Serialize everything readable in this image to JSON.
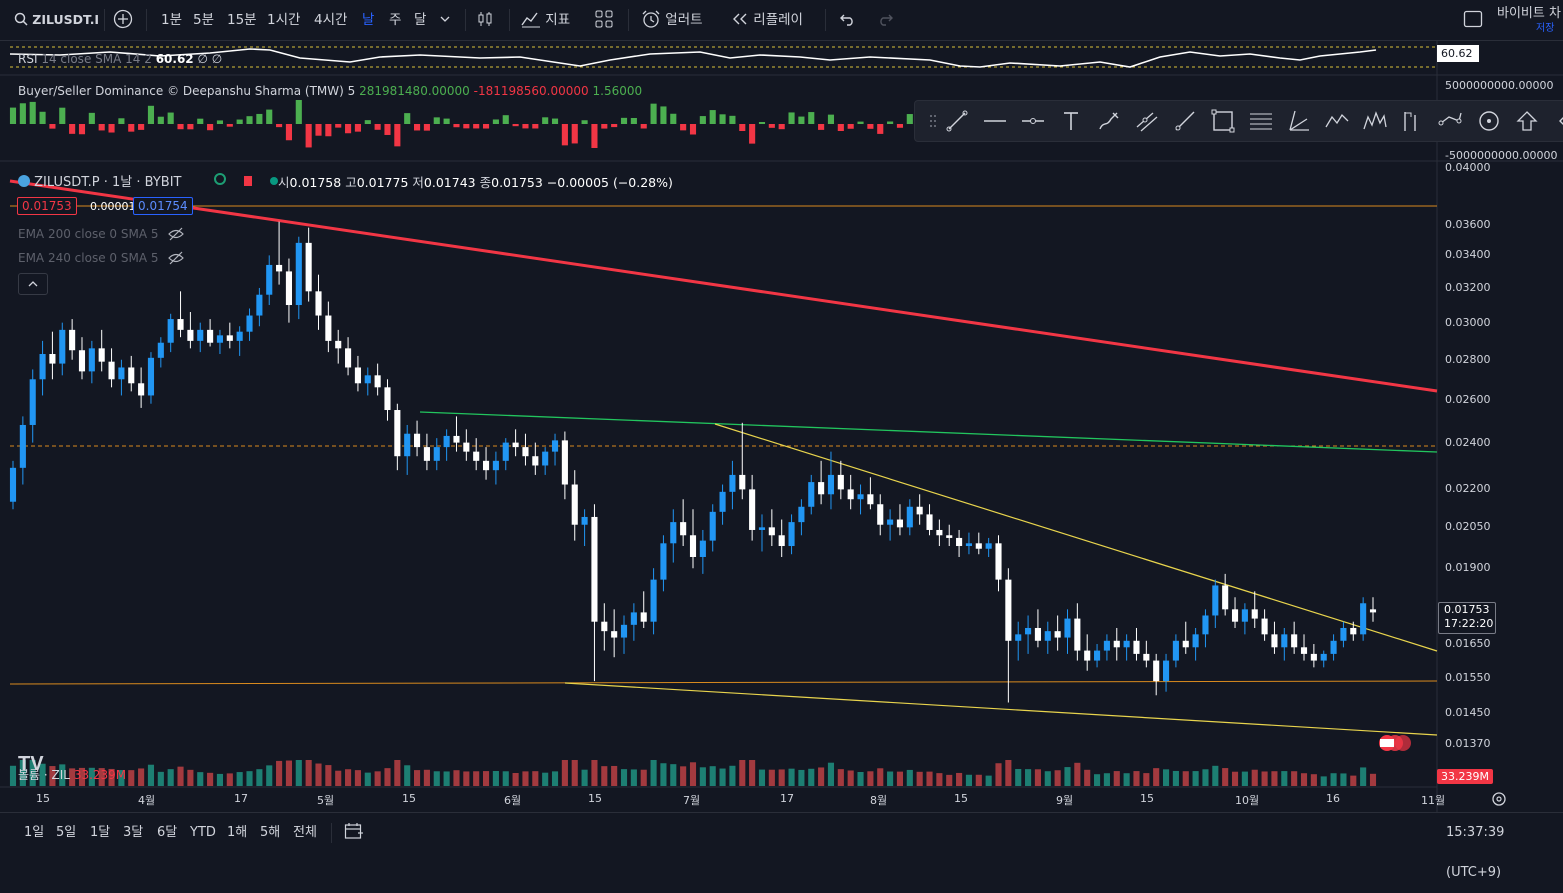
{
  "toolbar": {
    "symbol": "ZILUSDT.I",
    "timeframes": [
      "1분",
      "5분",
      "15분",
      "1시간",
      "4시간",
      "날",
      "주",
      "달"
    ],
    "active_timeframe": "날",
    "indicators_label": "지표",
    "alerts_label": "얼러트",
    "replay_label": "리플레이",
    "exchange_label": "바이비트 차",
    "save_label": "저장"
  },
  "rsi": {
    "label": "RSI",
    "params": "14 close SMA 14 2",
    "value": "60.62",
    "extra": "∅ ∅",
    "axis_value": "60.62"
  },
  "dominance": {
    "label": "Buyer/Seller Dominance © Deepanshu Sharma (TMW)",
    "param": "5",
    "v1": "281981480.00000",
    "v2": "-181198560.00000",
    "v3": "1.56000",
    "axis_top": "5000000000.00000",
    "axis_bottom": "-5000000000.00000"
  },
  "legend": {
    "symbol_line": "ZILUSDT.P · 1날 · BYBIT",
    "o_label": "시",
    "o": "0.01758",
    "h_label": "고",
    "h": "0.01775",
    "l_label": "저",
    "l": "0.01743",
    "c_label": "종",
    "c": "0.01753",
    "change": "−0.00005 (−0.28%)",
    "bid": "0.01753",
    "spread": "0.00001",
    "ask": "0.01754",
    "ema1": "EMA 200 close 0 SMA 5",
    "ema2": "EMA 240 close 0 SMA 5"
  },
  "price_axis": [
    "0.04000",
    "0.03600",
    "0.03400",
    "0.03200",
    "0.03000",
    "0.02800",
    "0.02600",
    "0.02400",
    "0.02200",
    "0.02050",
    "0.01900",
    "0.01650",
    "0.01550",
    "0.01450",
    "0.01370"
  ],
  "last_price": {
    "price": "0.01753",
    "countdown": "17:22:20"
  },
  "volume": {
    "label": "볼륨 · ZIL",
    "value": "33.239M",
    "axis_value": "33.239M"
  },
  "time_axis": [
    "15",
    "4월",
    "17",
    "5월",
    "15",
    "6월",
    "15",
    "7월",
    "17",
    "8월",
    "15",
    "9월",
    "15",
    "10월",
    "16",
    "11월"
  ],
  "bottom": {
    "ranges": [
      "1일",
      "5일",
      "1달",
      "3달",
      "6달",
      "YTD",
      "1해",
      "5해",
      "전체"
    ],
    "clock": "15:37:39 (UTC+9)"
  },
  "colors": {
    "background": "#131722",
    "up": "#2196f3",
    "down": "#ffffff",
    "red_trend": "#f23645",
    "green_trend": "#22c55e",
    "yellow_trend": "#e8d44d",
    "orange_level": "#d88a1e",
    "accent": "#2962ff"
  },
  "chart_data": {
    "type": "candlestick",
    "price_ylim": [
      0.0137,
      0.04
    ],
    "y_scale": "log",
    "levels": [
      0.0369,
      0.0238,
      0.01548
    ],
    "trendlines": [
      {
        "color": "red",
        "from": [
          0,
          0.0395
        ],
        "to": [
          1436,
          0.0262
        ]
      },
      {
        "color": "green",
        "from": [
          420,
          0.0253
        ],
        "to": [
          1436,
          0.0234
        ]
      },
      {
        "color": "yellow",
        "from": [
          715,
          0.0249
        ],
        "to": [
          1436,
          0.0162
        ]
      },
      {
        "color": "yellow",
        "from": [
          565,
          0.01548
        ],
        "to": [
          1436,
          0.01385
        ]
      }
    ],
    "ohlc": [
      [
        0.0215,
        0.0232,
        0.0212,
        0.0229
      ],
      [
        0.0229,
        0.0252,
        0.0222,
        0.0248
      ],
      [
        0.0248,
        0.0275,
        0.024,
        0.027
      ],
      [
        0.027,
        0.029,
        0.0262,
        0.0283
      ],
      [
        0.0283,
        0.0295,
        0.027,
        0.0278
      ],
      [
        0.0278,
        0.03,
        0.0272,
        0.0296
      ],
      [
        0.0296,
        0.0302,
        0.028,
        0.0285
      ],
      [
        0.0285,
        0.0292,
        0.027,
        0.0274
      ],
      [
        0.0274,
        0.029,
        0.0268,
        0.0286
      ],
      [
        0.0286,
        0.0296,
        0.0274,
        0.0279
      ],
      [
        0.0279,
        0.0286,
        0.0266,
        0.027
      ],
      [
        0.027,
        0.028,
        0.0262,
        0.0276
      ],
      [
        0.0276,
        0.0282,
        0.0264,
        0.0268
      ],
      [
        0.0268,
        0.0276,
        0.0256,
        0.0262
      ],
      [
        0.0262,
        0.0284,
        0.0258,
        0.0281
      ],
      [
        0.0281,
        0.0292,
        0.0276,
        0.0289
      ],
      [
        0.0289,
        0.0305,
        0.0284,
        0.0302
      ],
      [
        0.0302,
        0.0318,
        0.0292,
        0.0296
      ],
      [
        0.0296,
        0.0306,
        0.0286,
        0.029
      ],
      [
        0.029,
        0.03,
        0.0284,
        0.0296
      ],
      [
        0.0296,
        0.0302,
        0.0287,
        0.0289
      ],
      [
        0.0289,
        0.0296,
        0.0283,
        0.0293
      ],
      [
        0.0293,
        0.03,
        0.0286,
        0.029
      ],
      [
        0.029,
        0.0298,
        0.0282,
        0.0295
      ],
      [
        0.0295,
        0.0308,
        0.029,
        0.0304
      ],
      [
        0.0304,
        0.032,
        0.0298,
        0.0316
      ],
      [
        0.0316,
        0.034,
        0.031,
        0.0334
      ],
      [
        0.0334,
        0.0362,
        0.0322,
        0.033
      ],
      [
        0.033,
        0.0338,
        0.03,
        0.031
      ],
      [
        0.031,
        0.0352,
        0.0302,
        0.0348
      ],
      [
        0.0348,
        0.0358,
        0.0312,
        0.0318
      ],
      [
        0.0318,
        0.0328,
        0.0296,
        0.0304
      ],
      [
        0.0304,
        0.0312,
        0.0284,
        0.029
      ],
      [
        0.029,
        0.0296,
        0.0278,
        0.0286
      ],
      [
        0.0286,
        0.0292,
        0.0272,
        0.0276
      ],
      [
        0.0276,
        0.0282,
        0.0264,
        0.0268
      ],
      [
        0.0268,
        0.0276,
        0.0262,
        0.0272
      ],
      [
        0.0272,
        0.0278,
        0.0262,
        0.0266
      ],
      [
        0.0266,
        0.027,
        0.025,
        0.0255
      ],
      [
        0.0255,
        0.0258,
        0.0228,
        0.0234
      ],
      [
        0.0234,
        0.0248,
        0.0226,
        0.0244
      ],
      [
        0.0244,
        0.025,
        0.0234,
        0.0238
      ],
      [
        0.0238,
        0.0244,
        0.0228,
        0.0232
      ],
      [
        0.0232,
        0.0242,
        0.0228,
        0.0238
      ],
      [
        0.0238,
        0.0246,
        0.0232,
        0.0243
      ],
      [
        0.0243,
        0.0252,
        0.0236,
        0.024
      ],
      [
        0.024,
        0.0246,
        0.0232,
        0.0236
      ],
      [
        0.0236,
        0.0242,
        0.0228,
        0.0232
      ],
      [
        0.0232,
        0.0238,
        0.0224,
        0.0228
      ],
      [
        0.0228,
        0.0236,
        0.0222,
        0.0232
      ],
      [
        0.0232,
        0.0242,
        0.0228,
        0.024
      ],
      [
        0.024,
        0.0246,
        0.0234,
        0.0238
      ],
      [
        0.0238,
        0.0244,
        0.023,
        0.0234
      ],
      [
        0.0234,
        0.024,
        0.0226,
        0.023
      ],
      [
        0.023,
        0.0238,
        0.0226,
        0.0236
      ],
      [
        0.0236,
        0.0244,
        0.023,
        0.0241
      ],
      [
        0.0241,
        0.0245,
        0.0216,
        0.0222
      ],
      [
        0.0222,
        0.0228,
        0.02,
        0.0206
      ],
      [
        0.0206,
        0.0212,
        0.0198,
        0.0209
      ],
      [
        0.0209,
        0.0214,
        0.0154,
        0.0172
      ],
      [
        0.0172,
        0.0178,
        0.0163,
        0.0169
      ],
      [
        0.0169,
        0.0176,
        0.0161,
        0.0167
      ],
      [
        0.0167,
        0.0174,
        0.0162,
        0.0171
      ],
      [
        0.0171,
        0.0178,
        0.0166,
        0.0175
      ],
      [
        0.0175,
        0.0182,
        0.017,
        0.0172
      ],
      [
        0.0172,
        0.019,
        0.0168,
        0.0186
      ],
      [
        0.0186,
        0.0202,
        0.0182,
        0.0199
      ],
      [
        0.0199,
        0.0212,
        0.0192,
        0.0207
      ],
      [
        0.0207,
        0.0216,
        0.0198,
        0.0202
      ],
      [
        0.0202,
        0.0212,
        0.019,
        0.0194
      ],
      [
        0.0194,
        0.0204,
        0.0188,
        0.02
      ],
      [
        0.02,
        0.0214,
        0.0196,
        0.0211
      ],
      [
        0.0211,
        0.0222,
        0.0206,
        0.0219
      ],
      [
        0.0219,
        0.0232,
        0.0212,
        0.0226
      ],
      [
        0.0226,
        0.0249,
        0.0216,
        0.022
      ],
      [
        0.022,
        0.0226,
        0.02,
        0.0204
      ],
      [
        0.0204,
        0.021,
        0.0196,
        0.0205
      ],
      [
        0.0205,
        0.0212,
        0.0198,
        0.0202
      ],
      [
        0.0202,
        0.0208,
        0.0194,
        0.0198
      ],
      [
        0.0198,
        0.021,
        0.0195,
        0.0207
      ],
      [
        0.0207,
        0.0216,
        0.0202,
        0.0213
      ],
      [
        0.0213,
        0.0226,
        0.021,
        0.0223
      ],
      [
        0.0223,
        0.0232,
        0.0214,
        0.0218
      ],
      [
        0.0218,
        0.0236,
        0.0212,
        0.0226
      ],
      [
        0.0226,
        0.0232,
        0.0216,
        0.022
      ],
      [
        0.022,
        0.0226,
        0.0212,
        0.0216
      ],
      [
        0.0216,
        0.0222,
        0.021,
        0.0218
      ],
      [
        0.0218,
        0.0225,
        0.0212,
        0.0214
      ],
      [
        0.0214,
        0.0218,
        0.0202,
        0.0206
      ],
      [
        0.0206,
        0.0212,
        0.02,
        0.0208
      ],
      [
        0.0208,
        0.0214,
        0.0202,
        0.0205
      ],
      [
        0.0205,
        0.0216,
        0.0202,
        0.0213
      ],
      [
        0.0213,
        0.0218,
        0.0206,
        0.021
      ],
      [
        0.021,
        0.0214,
        0.0202,
        0.0204
      ],
      [
        0.0204,
        0.0208,
        0.0198,
        0.0202
      ],
      [
        0.0202,
        0.0206,
        0.0198,
        0.0201
      ],
      [
        0.0201,
        0.0204,
        0.0194,
        0.0198
      ],
      [
        0.0198,
        0.0203,
        0.0195,
        0.0199
      ],
      [
        0.0199,
        0.0203,
        0.0195,
        0.0197
      ],
      [
        0.0197,
        0.0201,
        0.0194,
        0.0199
      ],
      [
        0.0199,
        0.0202,
        0.0182,
        0.0186
      ],
      [
        0.0186,
        0.019,
        0.0148,
        0.0166
      ],
      [
        0.0166,
        0.0172,
        0.016,
        0.0168
      ],
      [
        0.0168,
        0.0174,
        0.0162,
        0.017
      ],
      [
        0.017,
        0.0176,
        0.0164,
        0.0166
      ],
      [
        0.0166,
        0.0172,
        0.0162,
        0.0169
      ],
      [
        0.0169,
        0.0174,
        0.0163,
        0.0167
      ],
      [
        0.0167,
        0.0176,
        0.0162,
        0.0173
      ],
      [
        0.0173,
        0.0178,
        0.016,
        0.0163
      ],
      [
        0.0163,
        0.0168,
        0.0157,
        0.016
      ],
      [
        0.016,
        0.0165,
        0.0158,
        0.0163
      ],
      [
        0.0163,
        0.0168,
        0.016,
        0.0166
      ],
      [
        0.0166,
        0.017,
        0.016,
        0.0164
      ],
      [
        0.0164,
        0.0168,
        0.016,
        0.0166
      ],
      [
        0.0166,
        0.017,
        0.016,
        0.0162
      ],
      [
        0.0162,
        0.0166,
        0.0158,
        0.016
      ],
      [
        0.016,
        0.0162,
        0.015,
        0.0154
      ],
      [
        0.0154,
        0.0162,
        0.0151,
        0.016
      ],
      [
        0.016,
        0.0168,
        0.0158,
        0.0166
      ],
      [
        0.0166,
        0.0172,
        0.0162,
        0.0164
      ],
      [
        0.0164,
        0.017,
        0.016,
        0.0168
      ],
      [
        0.0168,
        0.0176,
        0.0164,
        0.0174
      ],
      [
        0.0174,
        0.0186,
        0.017,
        0.0184
      ],
      [
        0.0184,
        0.0188,
        0.0174,
        0.0176
      ],
      [
        0.0176,
        0.018,
        0.017,
        0.0172
      ],
      [
        0.0172,
        0.0178,
        0.0168,
        0.0176
      ],
      [
        0.0176,
        0.0182,
        0.017,
        0.0173
      ],
      [
        0.0173,
        0.0176,
        0.0166,
        0.0168
      ],
      [
        0.0168,
        0.0172,
        0.0162,
        0.0164
      ],
      [
        0.0164,
        0.017,
        0.016,
        0.0168
      ],
      [
        0.0168,
        0.0172,
        0.0162,
        0.0164
      ],
      [
        0.0164,
        0.0168,
        0.016,
        0.0162
      ],
      [
        0.0162,
        0.0165,
        0.0158,
        0.016
      ],
      [
        0.016,
        0.0163,
        0.0158,
        0.0162
      ],
      [
        0.0162,
        0.0168,
        0.016,
        0.0166
      ],
      [
        0.0166,
        0.0172,
        0.0164,
        0.017
      ],
      [
        0.017,
        0.0172,
        0.0166,
        0.0168
      ],
      [
        0.0168,
        0.018,
        0.0166,
        0.0178
      ],
      [
        0.0176,
        0.018,
        0.0172,
        0.0175
      ]
    ]
  }
}
